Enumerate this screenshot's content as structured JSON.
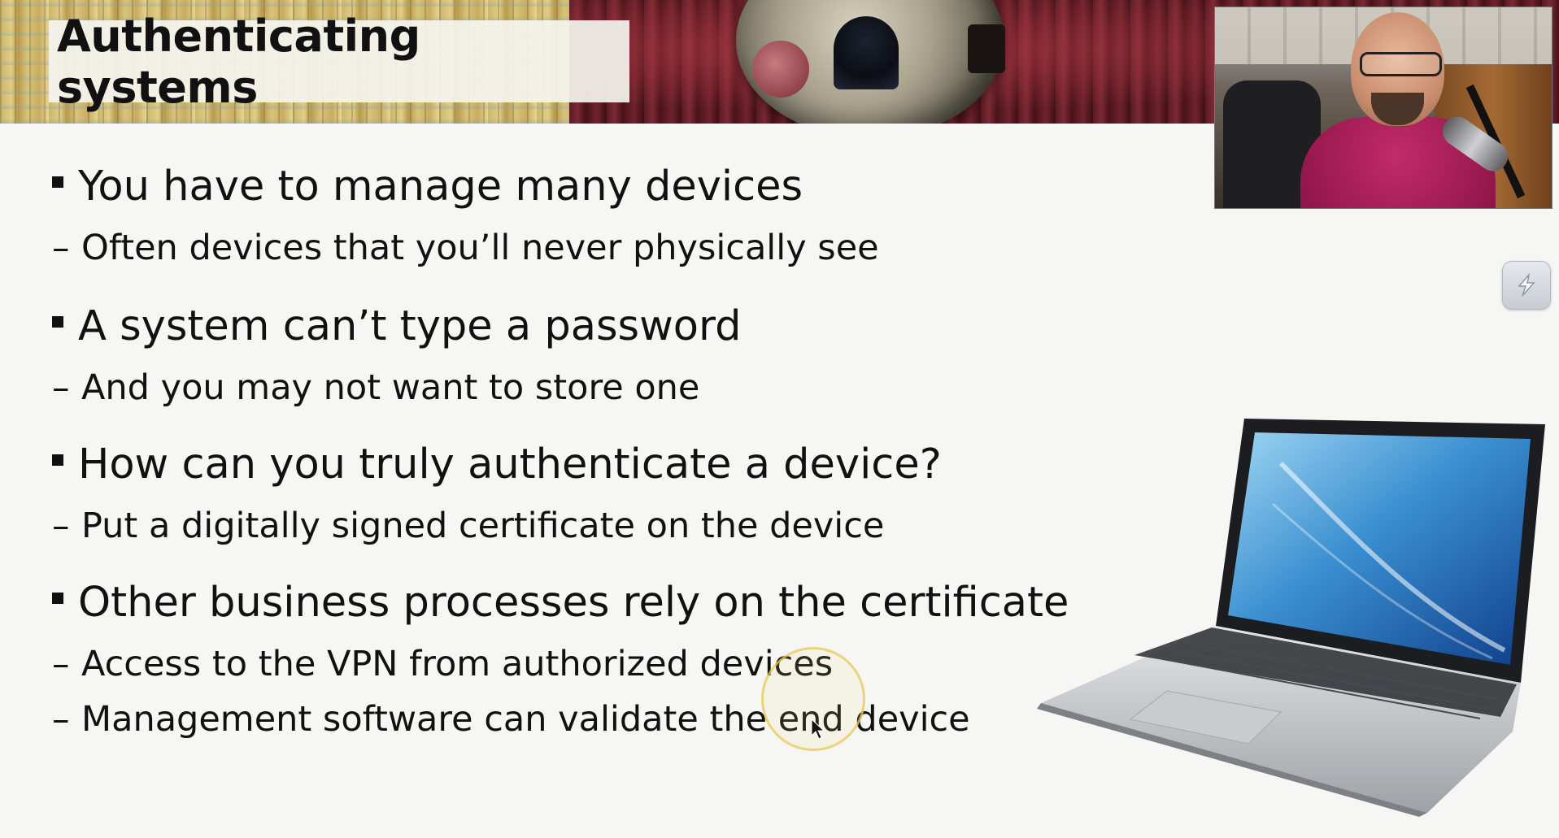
{
  "slide": {
    "title": "Authenticating systems",
    "bullets": [
      {
        "text": "You have to manage many devices",
        "subs": [
          "Often devices that you’ll never physically see"
        ]
      },
      {
        "text": "A system can’t type a password",
        "subs": [
          "And you may not want to store one"
        ]
      },
      {
        "text": "How can you truly authenticate a device?",
        "subs": [
          "Put a digitally signed certificate on the device"
        ]
      },
      {
        "text": "Other business processes rely on the certificate",
        "subs": [
          "Access to the VPN from authorized devices",
          "Management software can validate the end device"
        ]
      }
    ],
    "dash": "–"
  },
  "icons": {
    "tool_button": "snip-tool-icon",
    "laptop": "laptop-illustration",
    "cursor": "mouse-cursor-icon"
  },
  "colors": {
    "background": "#f6f6f4",
    "text": "#111111",
    "cursor_highlight": "#e6c85a",
    "presenter_shirt": "#c22b6a"
  }
}
